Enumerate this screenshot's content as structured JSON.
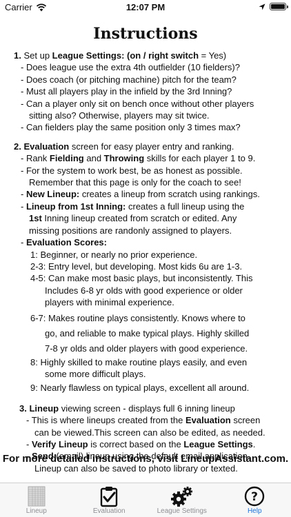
{
  "status_bar": {
    "carrier": "Carrier",
    "time": "12:07 PM",
    "battery_level": 1.0
  },
  "title": "Instructions",
  "section1": {
    "num": "1.",
    "lead": "Set up ",
    "bold": "League Settings: (on / right switch",
    "tail": " = Yes)",
    "items": [
      [
        "- Does league use the extra 4th outfielder (10 fielders)?"
      ],
      [
        "- Does coach (or pitching machine) pitch for the team?"
      ],
      [
        "- Must all players play in the infield by the 3rd Inning?"
      ],
      [
        "- Can a player only sit on bench once without other players",
        "sitting also?  Otherwise, players may sit twice."
      ],
      [
        "- Can fielders play the same position only 3 times max?"
      ]
    ]
  },
  "section2": {
    "num": "2.",
    "head_bold": "Evaluation",
    "head_tail": " screen for easy player entry and ranking.",
    "rank": {
      "a": "- Rank ",
      "b1": "Fielding",
      "c": " and ",
      "b2": "Throwing",
      "d": " skills for each player 1 to 9."
    },
    "honest": [
      "- For the system to work best, be as honest as possible.",
      "Remember that this page is only for the coach to see!"
    ],
    "new_lineup": {
      "dash": "- ",
      "bold": "New Lineup:",
      "tail": " creates a lineup from scratch using rankings."
    },
    "first_inning": {
      "dash": "- ",
      "bold": "Lineup from 1st Inning:",
      "tail": " creates a full lineup using the",
      "line2_bold": "1st",
      "line2_tail": " Inning lineup created from scratch or edited. Any",
      "line3": "missing positions are randonly assigned to players."
    },
    "scores_head": {
      "dash": "- ",
      "bold": "Evaluation Scores:"
    },
    "scores": [
      [
        "1: Beginner, or nearly no prior experience."
      ],
      [
        "2-3: Entry level, but developing. Most kids 6u are 1-3."
      ],
      [
        "4-5: Can make most basic plays, but inconsistently. This",
        "Includes 6-8 yr olds with good experience or older",
        "players with minimal experience."
      ],
      [
        "6-7: Makes routine plays consistently.  Knows where to",
        "go, and reliable to make typical plays. Highly skilled",
        "7-8 yr olds and older players with good experience."
      ],
      [
        "8: Highly skilled to make routine plays easily, and even",
        "some more difficult plays."
      ],
      [
        "9: Nearly flawless on typical plays, excellent all around."
      ]
    ]
  },
  "section3": {
    "num": "3.",
    "head_bold": "Lineup",
    "head_tail": " viewing screen - displays full 6 inning lineup",
    "where": {
      "a": "- This is where lineups created from the ",
      "bold": "Evaluation",
      "c": " screen",
      "line2": "can be viewed.This screen can also be edited, as needed."
    },
    "verify": {
      "dash": "- ",
      "bold": "Verify Lineup",
      "mid": " is correct based on the ",
      "bold2": "League Settings",
      "end": "."
    },
    "send": {
      "dash": "- ",
      "bold": "Send",
      "tail": " (email) lineup using the default email application.",
      "line2": "Lineup can also be saved to photo library or texted."
    }
  },
  "footer_link": "For more detailed instructions, visit LineupAssistant.com.",
  "tabs": [
    {
      "label": "Lineup",
      "icon": "lineup-sheet-icon",
      "active": false
    },
    {
      "label": "Evaluation",
      "icon": "checklist-icon",
      "active": false
    },
    {
      "label": "League Settings",
      "icon": "gears-icon",
      "active": false
    },
    {
      "label": "Help",
      "icon": "help-icon",
      "active": true
    }
  ],
  "colors": {
    "active_tab": "#1a73d9",
    "inactive_tab": "#8e8e93"
  }
}
